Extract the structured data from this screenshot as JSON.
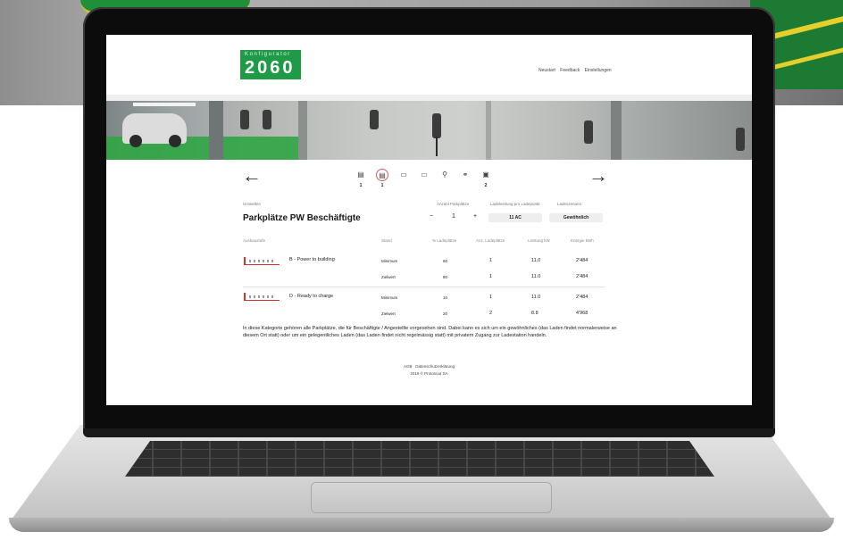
{
  "app": {
    "logo_line1": "Konfigurator",
    "logo_line2": "2060",
    "brand_color": "#1f9a46"
  },
  "topnav": {
    "items": [
      "Neustart",
      "Feedback",
      "Einstellungen"
    ]
  },
  "steps": {
    "back_icon": "arrow-left-icon",
    "forward_icon": "arrow-right-icon",
    "icons": [
      "parking-garage-icon",
      "parking-garage-icon",
      "parking-lot-icon",
      "parking-lot-icon",
      "motorcycle-icon",
      "bicycle-icon",
      "document-icon"
    ],
    "counts": [
      "1",
      "1",
      "",
      "",
      "",
      "",
      "2"
    ],
    "active_index": 1,
    "active_color": "#e05a5a"
  },
  "section": {
    "left_label": "Umwelten",
    "title": "Parkplätze PW Beschäftigte",
    "col_count_label": "Anzahl Parkplätze",
    "col_power_label": "Ladeleistung pro Ladepunkt",
    "col_type_label": "Ladeszenario",
    "count_value": "1",
    "minus": "−",
    "plus": "+",
    "power_value": "11 AC",
    "type_value": "Gewöhnlich"
  },
  "table": {
    "headers": [
      "Ausbaustufe",
      "Stand",
      "% Ladeplätze",
      "Anz. Ladeplätze",
      "Leistung kW",
      "Energie kWh"
    ],
    "groups": [
      {
        "name": "B - Power to building",
        "rows": [
          [
            "Minimum",
            "60",
            "1",
            "11.0",
            "2'484"
          ],
          [
            "Zielwert",
            "80",
            "1",
            "11.0",
            "2'484"
          ]
        ]
      },
      {
        "name": "D - Ready to charge",
        "rows": [
          [
            "Minimum",
            "10",
            "1",
            "11.0",
            "2'484"
          ],
          [
            "Zielwert",
            "20",
            "2",
            "8.8",
            "4'968"
          ]
        ]
      }
    ]
  },
  "description": "In diese Kategorie gehören alle Parkplätze, die für Beschäftigte / Angestellte vorgesehen sind. Dabei kann es sich um ein gewöhnliches (das Laden findet normalerweise an diesem Ort statt) oder um ein gelegentliches Laden (das Laden findet nicht regelmässig statt) mit privatem Zugang zur Ladestation handeln.",
  "footer": {
    "link1": "AGB",
    "link2": "Datenschutzerklärung",
    "copyright": "2019 © Protoscar SA"
  }
}
